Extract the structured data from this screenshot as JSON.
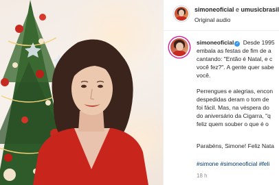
{
  "header": {
    "account": "simoneoficial",
    "connector": " e ",
    "coauthor": "umusicbrasil",
    "audio": "Original audio"
  },
  "caption": {
    "username": "simoneoficial",
    "lines": [
      "Desde 1995",
      "embala as festas de fim de a",
      "cantando: \"Então é Natal, e c",
      "você fez?\". A gente quer sabe",
      "você.",
      "Perrengues e alegrias, encon",
      "despedidas deram o tom de",
      "foi fácil. Mas, na véspera do",
      "do aniversário da Cigarra, \"q",
      "feliz quem souber o que é o",
      "Parabéns, Simone! Feliz Nata"
    ],
    "hashtags": "#simone #simoneoficial #feli"
  },
  "timestamp": "18 h",
  "colors": {
    "dress": "#c8261d",
    "hair": "#3a241b",
    "tree": "#2f5a2a",
    "link": "#00376b",
    "verified": "#3897f0"
  }
}
